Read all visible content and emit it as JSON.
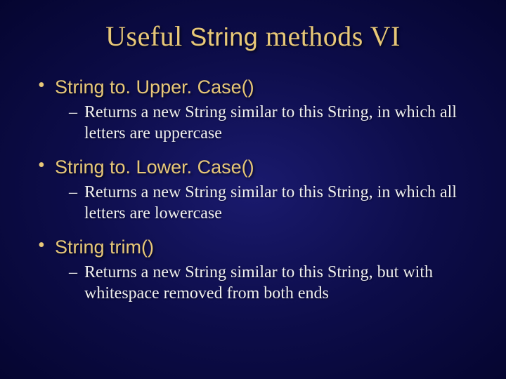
{
  "title": {
    "part1": "Useful ",
    "part2": "String",
    "part3": " methods VI"
  },
  "items": [
    {
      "method": "String to. Upper. Case()",
      "desc": "Returns a new String similar to this String, in which all letters are uppercase"
    },
    {
      "method": "String to. Lower. Case()",
      "desc": "Returns a new String similar to this String, in which all letters are lowercase"
    },
    {
      "method": "String trim()",
      "desc": "Returns a new String similar to this String, but with whitespace removed from both ends"
    }
  ]
}
